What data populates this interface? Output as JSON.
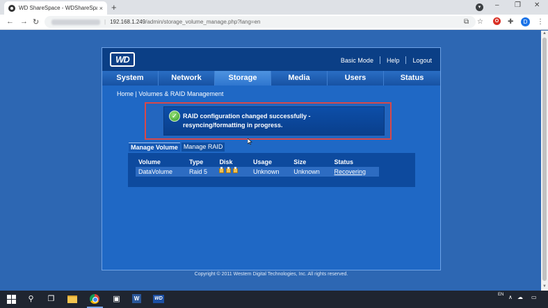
{
  "browser": {
    "tab_title": "WD ShareSpace - WDShareSpac",
    "tab_close": "×",
    "new_tab": "+",
    "url_host": "192.168.1.249",
    "url_path": "/admin/storage_volume_manage.php?lang=en",
    "back": "←",
    "forward": "→",
    "reload": "↻",
    "profile_initial": "D",
    "win_minimize": "–",
    "win_restore": "❐",
    "win_close": "✕"
  },
  "header": {
    "logo": "WD",
    "links": [
      "Basic Mode",
      "Help",
      "Logout"
    ]
  },
  "nav": {
    "tabs": [
      "System",
      "Network",
      "Storage",
      "Media",
      "Users",
      "Status"
    ],
    "active": "Storage"
  },
  "breadcrumb": "Home | Volumes & RAID Management",
  "notice": {
    "line1": "RAID configuration changed successfully -",
    "line2": "resyncing/formatting in progress.",
    "check": "✓"
  },
  "subtabs": [
    "Manage Volume",
    "Manage RAID"
  ],
  "volumes": {
    "headers": [
      "Volume",
      "Type",
      "Disk",
      "Usage",
      "Size",
      "Status"
    ],
    "rows": [
      {
        "volume": "DataVolume",
        "type": "Raid 5",
        "usage": "Unknown",
        "size": "Unknown",
        "status": "Recovering"
      }
    ]
  },
  "footer": {
    "copyright": "Copyright © 2011 Western Digital Technologies, Inc. All rights reserved."
  },
  "taskbar": {
    "language": "EN",
    "wd_label": "WD"
  }
}
